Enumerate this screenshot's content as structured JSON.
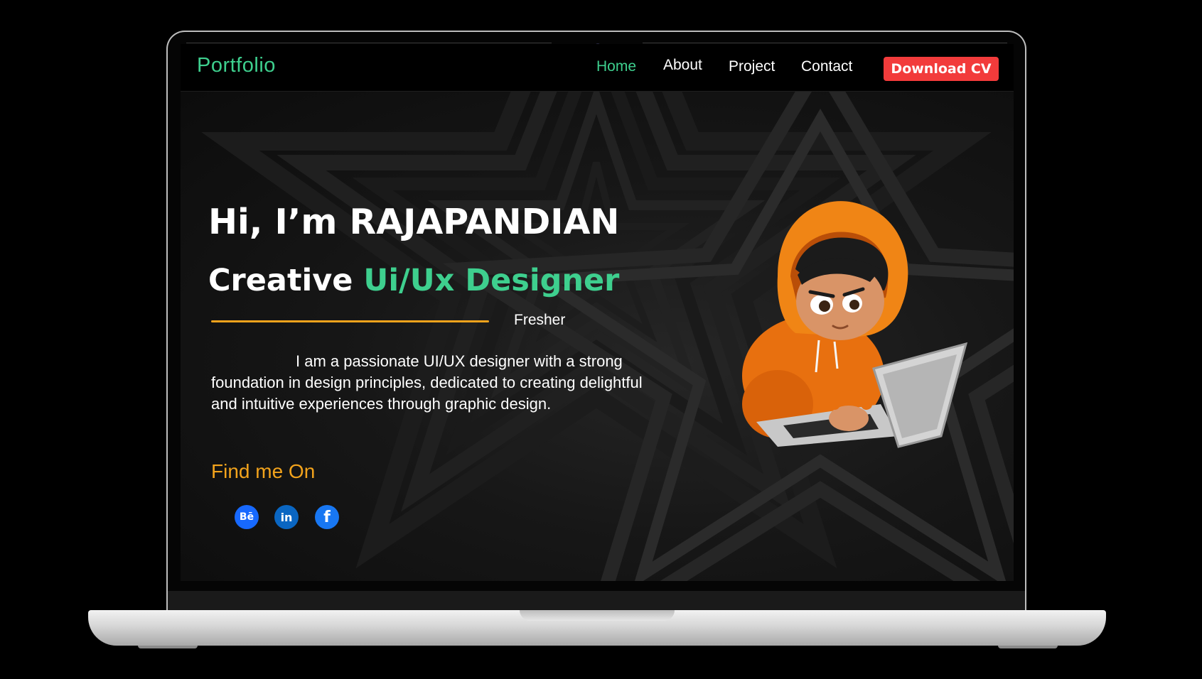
{
  "nav": {
    "logo": "Portfolio",
    "links": [
      {
        "label": "Home",
        "active": true
      },
      {
        "label": "About",
        "active": false
      },
      {
        "label": "Project",
        "active": false
      },
      {
        "label": "Contact",
        "active": false
      }
    ],
    "cta": "Download CV"
  },
  "hero": {
    "greeting": "Hi, I’m RAJAPANDIAN",
    "role_prefix": "Creative ",
    "role_highlight": "Ui/Ux Designer",
    "level": "Fresher",
    "bio": "I am a passionate UI/UX designer with a strong foundation in design principles, dedicated to creating delightful and intuitive experiences through graphic design.",
    "find_me": "Find me On"
  },
  "social": [
    {
      "icon": "behance-icon",
      "glyph": "Bē"
    },
    {
      "icon": "linkedin-icon",
      "glyph": "in"
    },
    {
      "icon": "facebook-icon",
      "glyph": "f"
    }
  ],
  "colors": {
    "accent_green": "#3ecf8e",
    "accent_orange": "#f2a31c",
    "cta_red": "#f23b3b",
    "background": "#000000"
  }
}
